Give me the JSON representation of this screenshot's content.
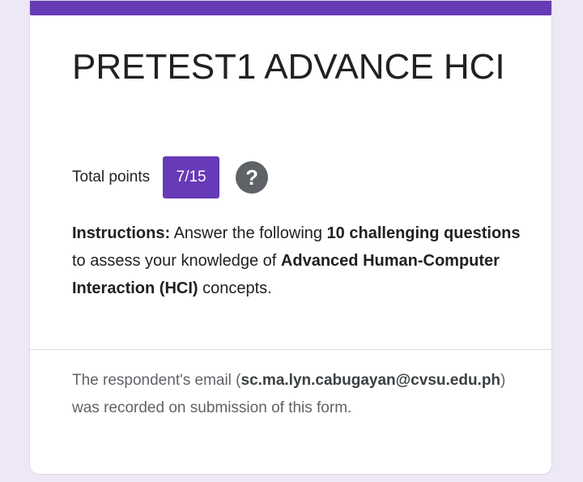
{
  "colors": {
    "accent": "#673ab7",
    "background": "#ede7f6",
    "card": "#ffffff",
    "text_primary": "#202124",
    "text_secondary": "#5f6368"
  },
  "form": {
    "title": "PRETEST1 ADVANCE HCI",
    "points_label": "Total points",
    "score": "7/15",
    "help_icon": "help-circle-icon",
    "help_glyph": "?"
  },
  "instructions": {
    "prefix": "Instructions:",
    "text_1": " Answer the following ",
    "bold_1": "10 challenging questions",
    "text_2": " to assess your knowledge of ",
    "bold_2": "Advanced Human-Computer Interaction (HCI)",
    "text_3": " concepts."
  },
  "respondent": {
    "text_before": "The respondent's email (",
    "email": "sc.ma.lyn.cabugayan@cvsu.edu.ph",
    "text_after": ") was recorded on submission of this form."
  }
}
